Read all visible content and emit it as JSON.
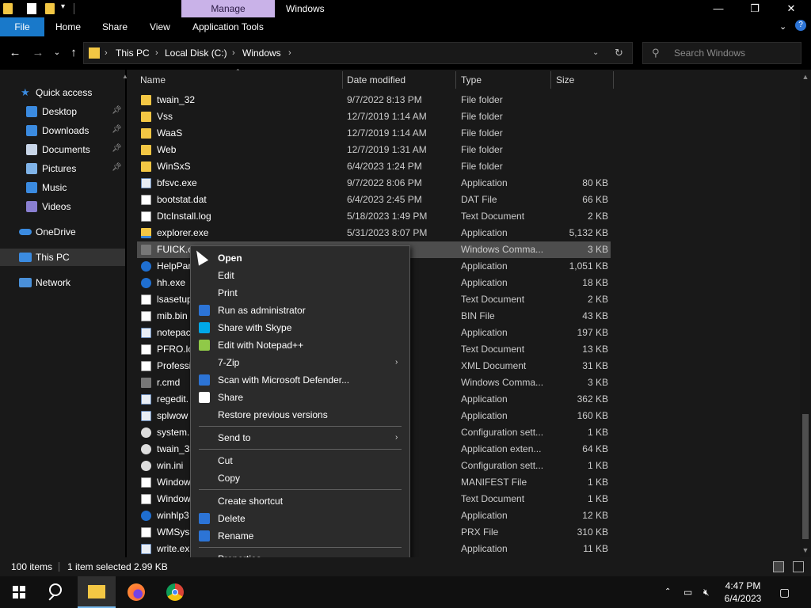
{
  "titlebar": {
    "manage_tab": "Manage",
    "title": "Windows"
  },
  "ribbon": {
    "tabs": [
      "File",
      "Home",
      "Share",
      "View",
      "Application Tools"
    ]
  },
  "address": {
    "crumbs": [
      "This PC",
      "Local Disk (C:)",
      "Windows"
    ]
  },
  "search": {
    "placeholder": "Search Windows"
  },
  "sidebar": {
    "quick_access": "Quick access",
    "items": [
      {
        "label": "Desktop",
        "icon": "desktop-icon",
        "color": "#3b8be0",
        "pinned": true
      },
      {
        "label": "Downloads",
        "icon": "download-icon",
        "color": "#3b8be0",
        "pinned": true
      },
      {
        "label": "Documents",
        "icon": "documents-icon",
        "color": "#c9d6e8",
        "pinned": true
      },
      {
        "label": "Pictures",
        "icon": "pictures-icon",
        "color": "#7fb3e8",
        "pinned": true
      },
      {
        "label": "Music",
        "icon": "music-icon",
        "color": "#3b8be0",
        "pinned": false
      },
      {
        "label": "Videos",
        "icon": "videos-icon",
        "color": "#8a7fd1",
        "pinned": false
      }
    ],
    "onedrive": "OneDrive",
    "this_pc": "This PC",
    "network": "Network"
  },
  "columns": {
    "name": "Name",
    "date": "Date modified",
    "type": "Type",
    "size": "Size"
  },
  "files": [
    {
      "name": "twain_32",
      "date": "9/7/2022 8:13 PM",
      "type": "File folder",
      "size": "",
      "icon": "folder"
    },
    {
      "name": "Vss",
      "date": "12/7/2019 1:14 AM",
      "type": "File folder",
      "size": "",
      "icon": "folder"
    },
    {
      "name": "WaaS",
      "date": "12/7/2019 1:14 AM",
      "type": "File folder",
      "size": "",
      "icon": "folder"
    },
    {
      "name": "Web",
      "date": "12/7/2019 1:31 AM",
      "type": "File folder",
      "size": "",
      "icon": "folder"
    },
    {
      "name": "WinSxS",
      "date": "6/4/2023 1:24 PM",
      "type": "File folder",
      "size": "",
      "icon": "folder"
    },
    {
      "name": "bfsvc.exe",
      "date": "9/7/2022 8:06 PM",
      "type": "Application",
      "size": "80 KB",
      "icon": "app"
    },
    {
      "name": "bootstat.dat",
      "date": "6/4/2023 2:45 PM",
      "type": "DAT File",
      "size": "66 KB",
      "icon": "doc"
    },
    {
      "name": "DtcInstall.log",
      "date": "5/18/2023 1:49 PM",
      "type": "Text Document",
      "size": "2 KB",
      "icon": "doc"
    },
    {
      "name": "explorer.exe",
      "date": "5/31/2023 8:07 PM",
      "type": "Application",
      "size": "5,132 KB",
      "icon": "explorer"
    },
    {
      "name": "FUICK.c",
      "date": "M",
      "type": "Windows Comma...",
      "size": "3 KB",
      "icon": "cmd",
      "selected": true
    },
    {
      "name": "HelpPar",
      "date": "PM",
      "type": "Application",
      "size": "1,051 KB",
      "icon": "help"
    },
    {
      "name": "hh.exe",
      "date": "PM",
      "type": "Application",
      "size": "18 KB",
      "icon": "help"
    },
    {
      "name": "lsasetup",
      "date": "PM",
      "type": "Text Document",
      "size": "2 KB",
      "icon": "doc"
    },
    {
      "name": "mib.bin",
      "date": "AM",
      "type": "BIN File",
      "size": "43 KB",
      "icon": "doc"
    },
    {
      "name": "notepac",
      "date": "M",
      "type": "Application",
      "size": "197 KB",
      "icon": "app"
    },
    {
      "name": "PFRO.lo",
      "date": "PM",
      "type": "Text Document",
      "size": "13 KB",
      "icon": "doc"
    },
    {
      "name": "Professi",
      "date": "AM",
      "type": "XML Document",
      "size": "31 KB",
      "icon": "doc"
    },
    {
      "name": "r.cmd",
      "date": "M",
      "type": "Windows Comma...",
      "size": "3 KB",
      "icon": "cmd"
    },
    {
      "name": "regedit.",
      "date": "AM",
      "type": "Application",
      "size": "362 KB",
      "icon": "app"
    },
    {
      "name": "splwow",
      "date": "PM",
      "type": "Application",
      "size": "160 KB",
      "icon": "app"
    },
    {
      "name": "system.i",
      "date": "AM",
      "type": "Configuration sett...",
      "size": "1 KB",
      "icon": "gear"
    },
    {
      "name": "twain_32",
      "date": "AM",
      "type": "Application exten...",
      "size": "64 KB",
      "icon": "gear"
    },
    {
      "name": "win.ini",
      "date": "AM",
      "type": "Configuration sett...",
      "size": "1 KB",
      "icon": "gear"
    },
    {
      "name": "Window",
      "date": "AM",
      "type": "MANIFEST File",
      "size": "1 KB",
      "icon": "doc"
    },
    {
      "name": "Window",
      "date": "M",
      "type": "Text Document",
      "size": "1 KB",
      "icon": "doc"
    },
    {
      "name": "winhlp3",
      "date": "AM",
      "type": "Application",
      "size": "12 KB",
      "icon": "help"
    },
    {
      "name": "WMSysP",
      "date": "AM",
      "type": "PRX File",
      "size": "310 KB",
      "icon": "doc"
    },
    {
      "name": "write.ex",
      "date": "AM",
      "type": "Application",
      "size": "11 KB",
      "icon": "app"
    }
  ],
  "context_menu": [
    {
      "label": "Open",
      "bold": true
    },
    {
      "label": "Edit"
    },
    {
      "label": "Print"
    },
    {
      "label": "Run as administrator",
      "icon": "shield-icon",
      "color": "#2c74d6"
    },
    {
      "label": "Share with Skype",
      "icon": "skype-icon",
      "color": "#00a8e8"
    },
    {
      "label": "Edit with Notepad++",
      "icon": "notepadpp-icon",
      "color": "#90c948"
    },
    {
      "label": "7-Zip",
      "submenu": true
    },
    {
      "label": "Scan with Microsoft Defender...",
      "icon": "defender-icon",
      "color": "#2c74d6"
    },
    {
      "label": "Share",
      "icon": "share-icon",
      "color": "#ffffff"
    },
    {
      "label": "Restore previous versions"
    },
    {
      "separator": true
    },
    {
      "label": "Send to",
      "submenu": true
    },
    {
      "separator": true
    },
    {
      "label": "Cut"
    },
    {
      "label": "Copy"
    },
    {
      "separator": true
    },
    {
      "label": "Create shortcut"
    },
    {
      "label": "Delete",
      "icon": "shield-icon",
      "color": "#2c74d6"
    },
    {
      "label": "Rename",
      "icon": "shield-icon",
      "color": "#2c74d6"
    },
    {
      "separator": true
    },
    {
      "label": "Properties"
    }
  ],
  "status": {
    "items": "100 items",
    "selected": "1 item selected  2.99 KB"
  },
  "clock": {
    "time": "4:47 PM",
    "date": "6/4/2023"
  },
  "colors": {
    "accent": "#1979ca",
    "folder": "#f3c744",
    "manage_tab": "#c9b2e8"
  }
}
